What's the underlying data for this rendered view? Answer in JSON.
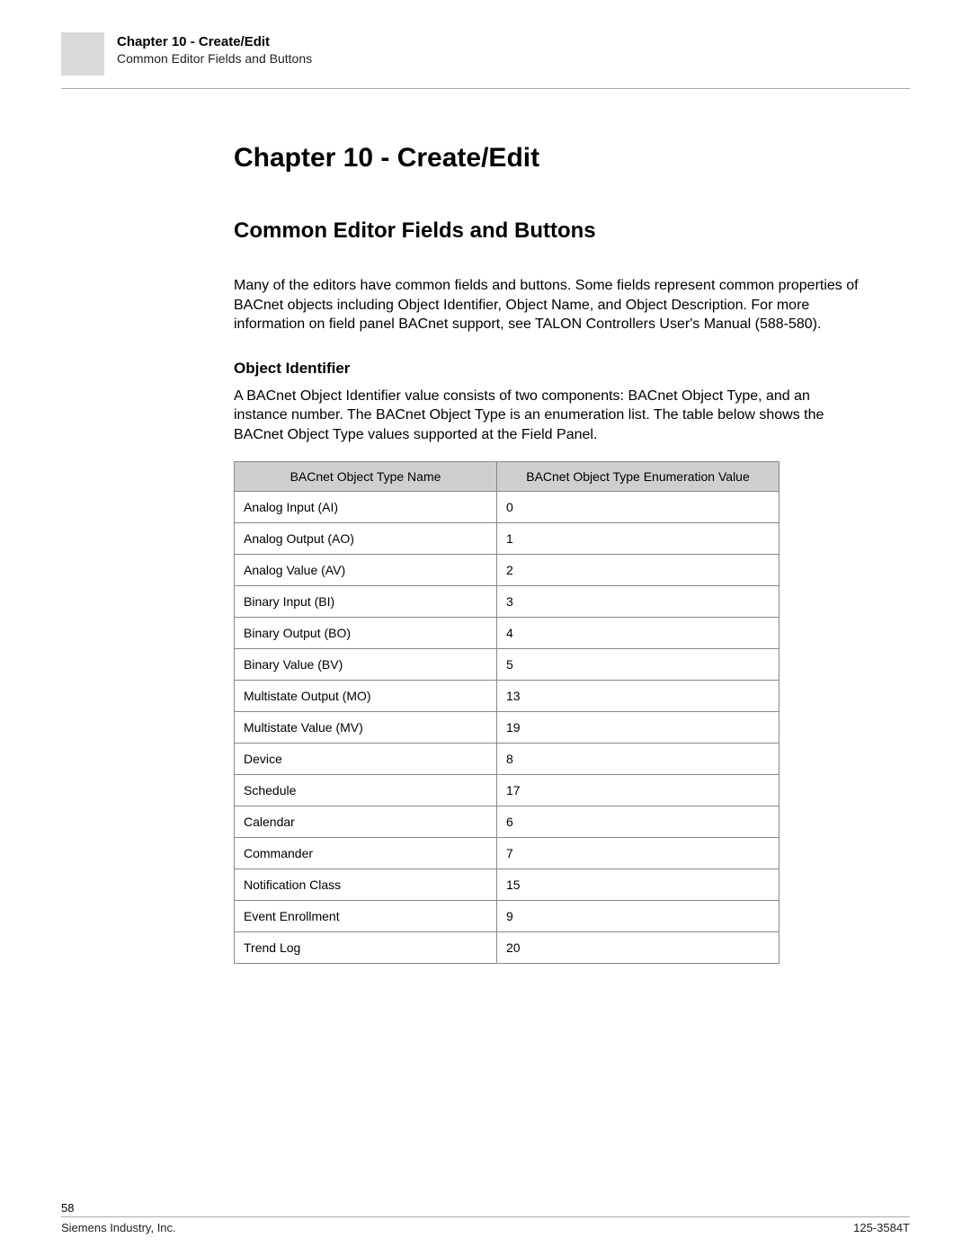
{
  "header": {
    "chapter": "Chapter 10 - Create/Edit",
    "subtitle": "Common Editor Fields and Buttons"
  },
  "content": {
    "chapter_title": "Chapter 10 - Create/Edit",
    "section_title": "Common Editor Fields and Buttons",
    "intro_paragraph": "Many of the editors have common fields and buttons. Some fields represent common properties of BACnet objects including Object Identifier, Object Name, and Object Description. For more information on field panel BACnet support, see TALON Controllers User's Manual (588-580).",
    "subsection_title": "Object Identifier",
    "sub_paragraph": "A BACnet Object Identifier value consists of two components: BACnet Object Type, and an instance number. The BACnet Object Type is an enumeration list. The table below shows the BACnet Object Type values supported at the Field Panel.",
    "table": {
      "headers": [
        "BACnet Object Type Name",
        "BACnet Object Type Enumeration Value"
      ],
      "rows": [
        [
          "Analog Input (AI)",
          "0"
        ],
        [
          "Analog Output (AO)",
          "1"
        ],
        [
          "Analog Value (AV)",
          "2"
        ],
        [
          "Binary Input (BI)",
          "3"
        ],
        [
          "Binary Output (BO)",
          "4"
        ],
        [
          "Binary Value (BV)",
          "5"
        ],
        [
          "Multistate Output (MO)",
          "13"
        ],
        [
          "Multistate Value (MV)",
          "19"
        ],
        [
          "Device",
          "8"
        ],
        [
          "Schedule",
          "17"
        ],
        [
          "Calendar",
          "6"
        ],
        [
          "Commander",
          "7"
        ],
        [
          "Notification Class",
          "15"
        ],
        [
          "Event Enrollment",
          "9"
        ],
        [
          "Trend Log",
          "20"
        ]
      ]
    }
  },
  "footer": {
    "page_number": "58",
    "company": "Siemens Industry, Inc.",
    "doc_number": "125-3584T"
  }
}
